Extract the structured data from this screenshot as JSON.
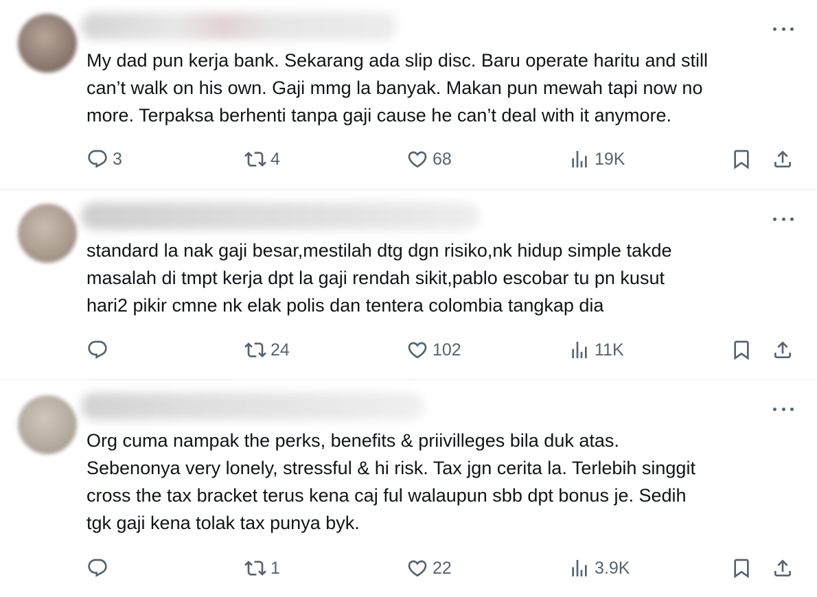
{
  "tweets": [
    {
      "lines": [
        "My dad pun kerja bank. Sekarang ada slip disc. Baru operate haritu and still",
        "can’t walk on his own. Gaji mmg la banyak. Makan pun mewah tapi now no",
        "more. Terpaksa berhenti tanpa gaji cause he can’t deal with it anymore."
      ],
      "replies": "3",
      "retweets": "4",
      "likes": "68",
      "views": "19K"
    },
    {
      "lines": [
        "standard la nak gaji besar,mestilah dtg dgn risiko,nk hidup simple takde",
        "masalah di tmpt kerja dpt la gaji rendah sikit,pablo escobar tu pn kusut",
        "hari2 pikir cmne nk elak polis dan tentera colombia tangkap dia"
      ],
      "replies": "",
      "retweets": "24",
      "likes": "102",
      "views": "11K"
    },
    {
      "lines": [
        "Org cuma nampak the perks, benefits & priivilleges bila duk atas.",
        "Sebenonya very lonely, stressful & hi risk. Tax jgn cerita la. Terlebih singgit",
        "cross the tax bracket terus kena caj ful walaupun sbb dpt bonus je. Sedih",
        "tgk gaji kena tolak tax punya byk."
      ],
      "replies": "",
      "retweets": "1",
      "likes": "22",
      "views": "3.9K"
    }
  ],
  "icons": {
    "reply": "reply-icon",
    "retweet": "retweet-icon",
    "like": "heart-icon",
    "views": "views-icon",
    "bookmark": "bookmark-icon",
    "share": "share-icon",
    "more": "more-icon"
  },
  "colors": {
    "text": "#0f1419",
    "secondary": "#536471",
    "divider": "#e6e9ec"
  }
}
